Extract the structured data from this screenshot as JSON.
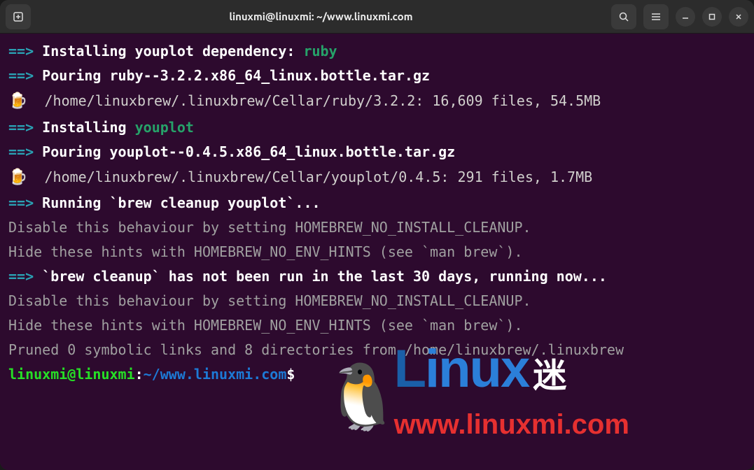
{
  "window": {
    "title": "linuxmi@linuxmi: ~/www.linuxmi.com"
  },
  "lines": {
    "l1_prefix": "==>",
    "l1_text": " Installing youplot dependency: ",
    "l1_pkg": "ruby",
    "l2_prefix": "==>",
    "l2_text": " Pouring ruby--3.2.2.x86_64_linux.bottle.tar.gz",
    "l3_icon": "🍺",
    "l3_text": "  /home/linuxbrew/.linuxbrew/Cellar/ruby/3.2.2: 16,609 files, 54.5MB",
    "l4_prefix": "==>",
    "l4_text": " Installing ",
    "l4_pkg": "youplot",
    "l5_prefix": "==>",
    "l5_text": " Pouring youplot--0.4.5.x86_64_linux.bottle.tar.gz",
    "l6_icon": "🍺",
    "l6_text": "  /home/linuxbrew/.linuxbrew/Cellar/youplot/0.4.5: 291 files, 1.7MB",
    "l7_prefix": "==>",
    "l7_text": " Running `brew cleanup youplot`...",
    "l8": "Disable this behaviour by setting HOMEBREW_NO_INSTALL_CLEANUP.",
    "l9": "Hide these hints with HOMEBREW_NO_ENV_HINTS (see `man brew`).",
    "l10_prefix": "==>",
    "l10_text": " `brew cleanup` has not been run in the last 30 days, running now...",
    "l11": "Disable this behaviour by setting HOMEBREW_NO_INSTALL_CLEANUP.",
    "l12": "Hide these hints with HOMEBREW_NO_ENV_HINTS (see `man brew`).",
    "l13": "Pruned 0 symbolic links and 8 directories from /home/linuxbrew/.linuxbrew",
    "prompt_user": "linuxmi@linuxmi",
    "prompt_sep1": ":",
    "prompt_path": "~/www.linuxmi.com",
    "prompt_end": "$"
  },
  "watermark": {
    "brand": "Linux",
    "suffix": "迷",
    "url": "www.linuxmi.com"
  }
}
